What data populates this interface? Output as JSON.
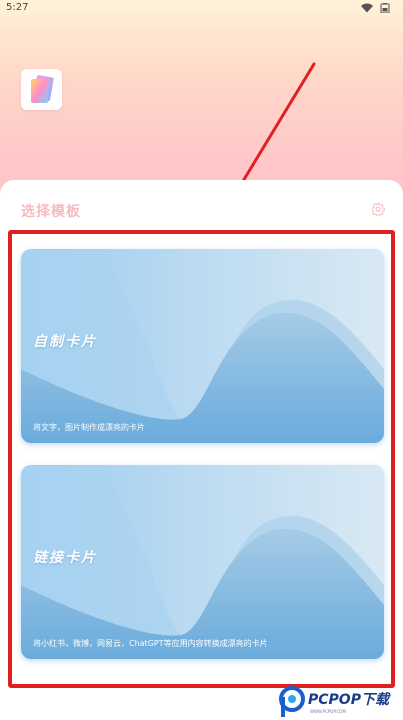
{
  "status_bar": {
    "time": "5:27"
  },
  "sheet": {
    "title": "选择模板",
    "title_color": "#f5bcc0"
  },
  "cards": [
    {
      "title": "自制卡片",
      "description": "将文字，图片制作成漂亮的卡片"
    },
    {
      "title": "链接卡片",
      "description": "将小红书，微博，网易云，ChatGPT等应用内容转换成漂亮的卡片"
    }
  ],
  "watermark": {
    "brand": "PCPOP下载",
    "sub": "WWW.PCPOP.COM"
  },
  "colors": {
    "annotation_red": "#e02020",
    "card_blue": "#7fb6e0",
    "settings_icon": "#f5bcc0",
    "background_pink": "#ffc3c6"
  },
  "icons": {
    "status": [
      "wifi-icon",
      "battery-icon"
    ],
    "sheet": "settings-icon"
  }
}
